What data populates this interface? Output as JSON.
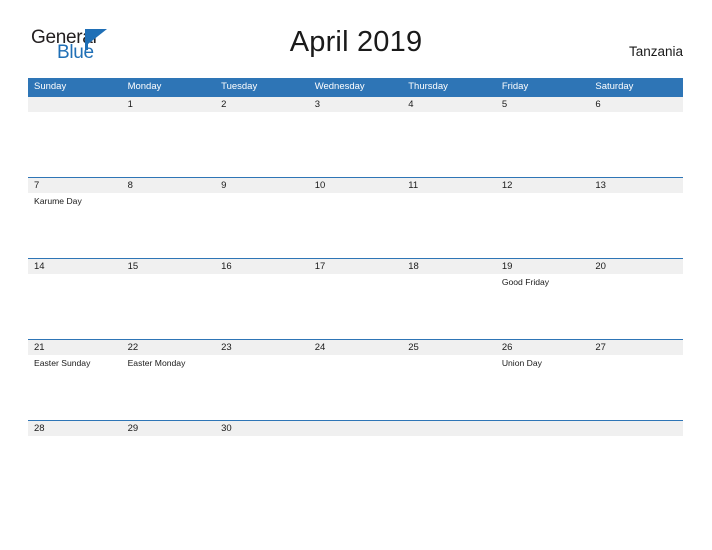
{
  "brand": {
    "name_part1": "General",
    "name_part2": "Blue",
    "flag_icon": "flag-triangle-icon"
  },
  "header": {
    "title": "April 2019",
    "country": "Tanzania"
  },
  "calendar": {
    "month": "April",
    "year": "2019",
    "weekday_headers": [
      "Sunday",
      "Monday",
      "Tuesday",
      "Wednesday",
      "Thursday",
      "Friday",
      "Saturday"
    ],
    "colors": {
      "header_band": "#2e75b6",
      "date_strip": "#f0f0f0",
      "rule": "#2e75b6",
      "text": "#1a1a1a",
      "brand_blue": "#1f6fb6"
    },
    "weeks": [
      {
        "days": [
          {
            "date": "",
            "event": ""
          },
          {
            "date": "1",
            "event": ""
          },
          {
            "date": "2",
            "event": ""
          },
          {
            "date": "3",
            "event": ""
          },
          {
            "date": "4",
            "event": ""
          },
          {
            "date": "5",
            "event": ""
          },
          {
            "date": "6",
            "event": ""
          }
        ]
      },
      {
        "days": [
          {
            "date": "7",
            "event": "Karume Day"
          },
          {
            "date": "8",
            "event": ""
          },
          {
            "date": "9",
            "event": ""
          },
          {
            "date": "10",
            "event": ""
          },
          {
            "date": "11",
            "event": ""
          },
          {
            "date": "12",
            "event": ""
          },
          {
            "date": "13",
            "event": ""
          }
        ]
      },
      {
        "days": [
          {
            "date": "14",
            "event": ""
          },
          {
            "date": "15",
            "event": ""
          },
          {
            "date": "16",
            "event": ""
          },
          {
            "date": "17",
            "event": ""
          },
          {
            "date": "18",
            "event": ""
          },
          {
            "date": "19",
            "event": "Good Friday"
          },
          {
            "date": "20",
            "event": ""
          }
        ]
      },
      {
        "days": [
          {
            "date": "21",
            "event": "Easter Sunday"
          },
          {
            "date": "22",
            "event": "Easter Monday"
          },
          {
            "date": "23",
            "event": ""
          },
          {
            "date": "24",
            "event": ""
          },
          {
            "date": "25",
            "event": ""
          },
          {
            "date": "26",
            "event": "Union Day"
          },
          {
            "date": "27",
            "event": ""
          }
        ]
      },
      {
        "days": [
          {
            "date": "28",
            "event": ""
          },
          {
            "date": "29",
            "event": ""
          },
          {
            "date": "30",
            "event": ""
          },
          {
            "date": "",
            "event": ""
          },
          {
            "date": "",
            "event": ""
          },
          {
            "date": "",
            "event": ""
          },
          {
            "date": "",
            "event": ""
          }
        ]
      }
    ]
  }
}
